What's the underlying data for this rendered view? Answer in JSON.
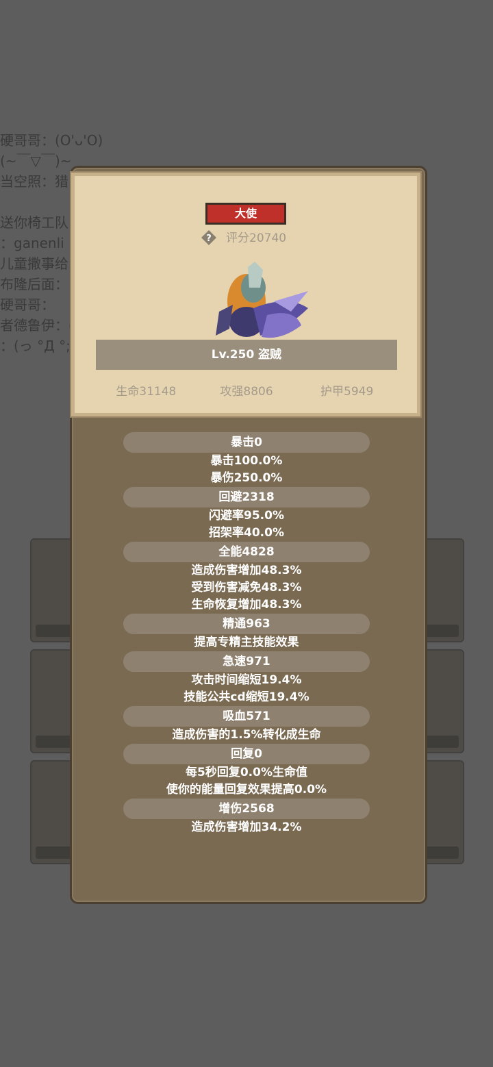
{
  "background": {
    "chat_lines": [
      "",
      "硬哥哥：(O'ᴗ'O)",
      " (~￣▽￣)~",
      "当空照：猎",
      "",
      "送你椅工队",
      "：ganenli",
      "儿童撒事给",
      "布隆后面：",
      "硬哥哥：",
      "者德鲁伊：(",
      "：(っ °Д °;)"
    ]
  },
  "card": {
    "rank": "大使",
    "score": "评分20740",
    "name": "Lv.250 盗贼",
    "stats": [
      "生命31148",
      "攻强8806",
      "护甲5949"
    ]
  },
  "stat_groups": [
    {
      "header": "暴击0",
      "lines": [
        "暴击100.0%",
        "暴伤250.0%"
      ]
    },
    {
      "header": "回避2318",
      "lines": [
        "闪避率95.0%",
        "招架率40.0%"
      ]
    },
    {
      "header": "全能4828",
      "lines": [
        "造成伤害增加48.3%",
        "受到伤害减免48.3%",
        "生命恢复增加48.3%"
      ]
    },
    {
      "header": "精通963",
      "lines": [
        "提高专精主技能效果"
      ]
    },
    {
      "header": "急速971",
      "lines": [
        "攻击时间缩短19.4%",
        "技能公共cd缩短19.4%"
      ]
    },
    {
      "header": "吸血571",
      "lines": [
        "造成伤害的1.5%转化成生命"
      ]
    },
    {
      "header": "回复0",
      "lines": [
        "每5秒回复0.0%生命值",
        "使你的能量回复效果提高0.0%"
      ]
    },
    {
      "header": "增伤2568",
      "lines": [
        "造成伤害增加34.2%"
      ]
    }
  ],
  "colors": {
    "badge": "#c0302b",
    "card": "#e6d4b1",
    "panel": "#7a6a52"
  },
  "icons": {
    "help": "question-diamond-icon"
  }
}
